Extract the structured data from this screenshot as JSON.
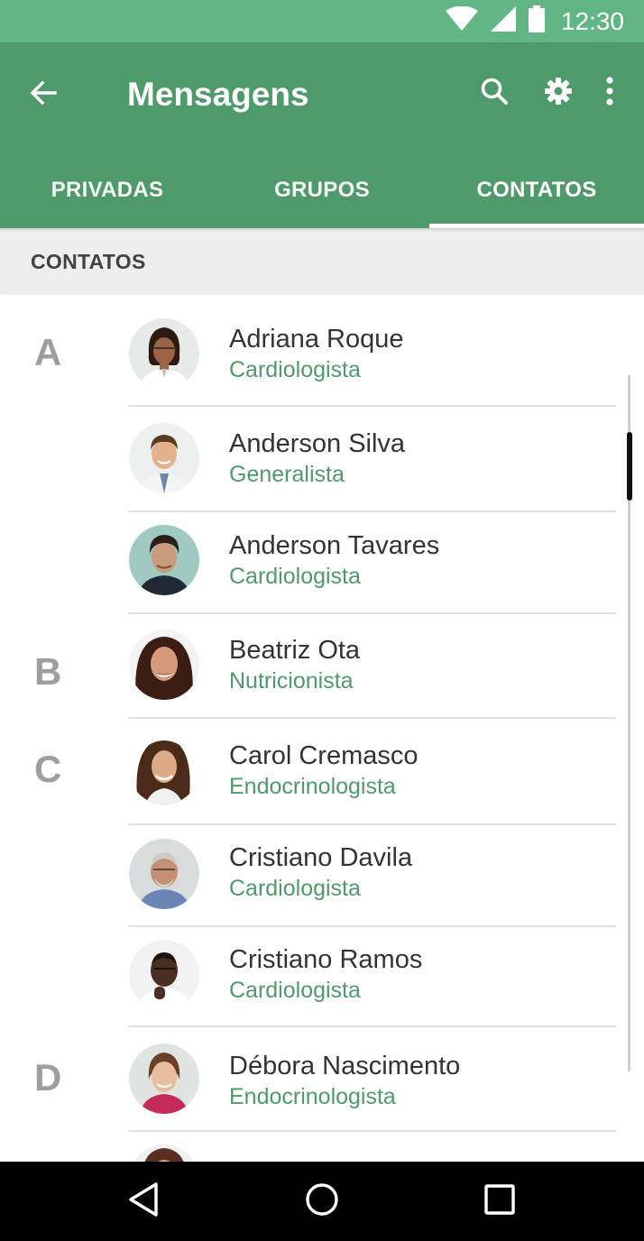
{
  "status_bar": {
    "time": "12:30",
    "icons": [
      "wifi-icon",
      "signal-icon",
      "battery-icon"
    ]
  },
  "app_bar": {
    "title": "Mensagens",
    "back_icon": "arrow-back-icon",
    "actions": [
      "search-icon",
      "settings-gear-icon",
      "more-vert-icon"
    ],
    "background": "#4e9a6a"
  },
  "tabs": [
    {
      "label": "PRIVADAS",
      "selected": false
    },
    {
      "label": "GRUPOS",
      "selected": false
    },
    {
      "label": "CONTATOS",
      "selected": true
    }
  ],
  "section": {
    "title": "CONTATOS"
  },
  "contacts": [
    {
      "letter": "A",
      "name": "Adriana Roque",
      "specialty": "Cardiologista"
    },
    {
      "letter": "",
      "name": "Anderson Silva",
      "specialty": "Generalista"
    },
    {
      "letter": "",
      "name": "Anderson Tavares",
      "specialty": "Cardiologista"
    },
    {
      "letter": "B",
      "name": "Beatriz Ota",
      "specialty": "Nutricionista"
    },
    {
      "letter": "C",
      "name": "Carol Cremasco",
      "specialty": "Endocrinologista"
    },
    {
      "letter": "",
      "name": "Cristiano Davila",
      "specialty": "Cardiologista"
    },
    {
      "letter": "",
      "name": "Cristiano Ramos",
      "specialty": "Cardiologista"
    },
    {
      "letter": "D",
      "name": "Débora Nascimento",
      "specialty": "Endocrinologista"
    }
  ],
  "nav_bar": {
    "buttons": [
      "nav-back-icon",
      "nav-home-icon",
      "nav-recents-icon"
    ]
  },
  "colors": {
    "accent": "#4e9a6a",
    "status_bar": "#62b685",
    "section_bg": "#eeeeee"
  }
}
